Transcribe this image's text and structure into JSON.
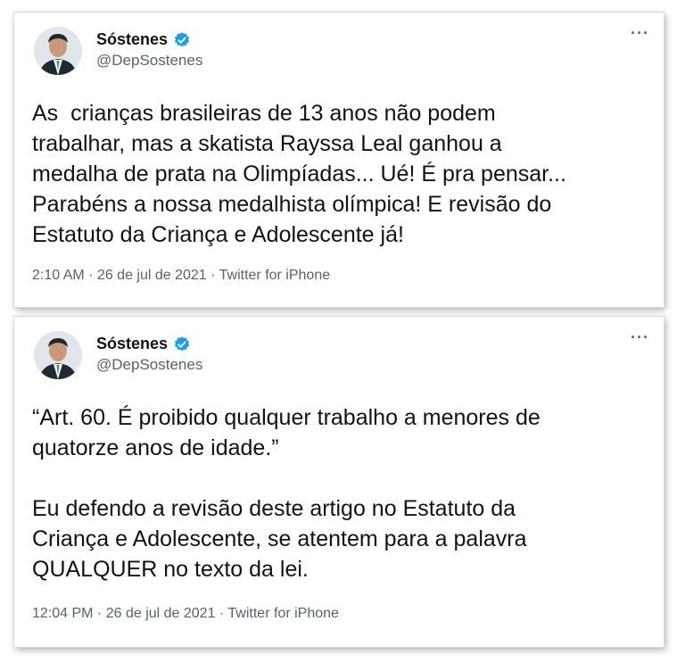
{
  "tweets": [
    {
      "author": {
        "name": "Sóstenes",
        "handle": "@DepSostenes",
        "verified_icon": "verified-badge-icon"
      },
      "text": "As  crianças brasileiras de 13 anos não podem\ntrabalhar, mas a skatista Rayssa Leal ganhou a\nmedalha de prata na Olimpíadas... Ué! É pra pensar...\nParabéns a nossa medalhista olímpica! E revisão do\nEstatuto da Criança e Adolescente já!",
      "meta": "2:10 AM · 26 de jul de 2021 · Twitter for iPhone",
      "more": "···"
    },
    {
      "author": {
        "name": "Sóstenes",
        "handle": "@DepSostenes",
        "verified_icon": "verified-badge-icon"
      },
      "text": "“Art. 60. É proibido qualquer trabalho a menores de\nquatorze anos de idade.”\n\nEu defendo a revisão deste artigo no Estatuto da\nCriança e Adolescente, se atentem para a palavra\nQUALQUER no texto da lei.",
      "meta": "12:04 PM · 26 de jul de 2021 · Twitter for iPhone",
      "more": "···"
    }
  ],
  "colors": {
    "verified": "#1d9bf0",
    "text": "#0f1419",
    "secondary": "#536471"
  }
}
